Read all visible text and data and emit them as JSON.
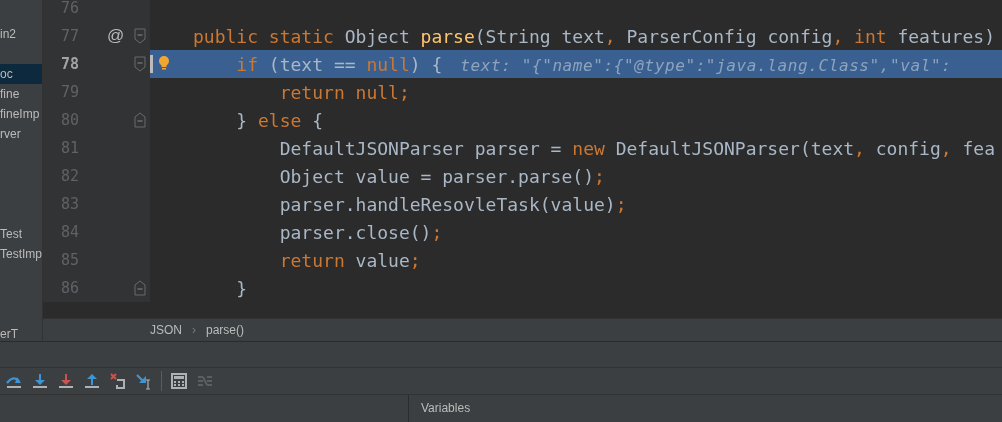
{
  "sidebar": {
    "items": [
      {
        "label": "in2",
        "selected": false
      },
      {
        "label": "oc",
        "selected": true
      },
      {
        "label": "fine",
        "selected": false
      },
      {
        "label": "fineImp",
        "selected": false
      },
      {
        "label": "rver",
        "selected": false
      },
      {
        "label": "Test",
        "selected": false
      },
      {
        "label": "TestImp",
        "selected": false
      },
      {
        "label": "erT",
        "selected": false
      }
    ]
  },
  "editor": {
    "lines": [
      {
        "number": "76",
        "current": false,
        "bulb": false,
        "fold_start": false,
        "fold_end": false
      },
      {
        "number": "77",
        "current": false,
        "bulb": false,
        "fold_start": true,
        "fold_end": false,
        "gutter_mark": "@",
        "tokens": [
          {
            "kind": "keyword",
            "text": "public static "
          },
          {
            "kind": "plain",
            "text": "Object "
          },
          {
            "kind": "method",
            "text": "parse"
          },
          {
            "kind": "plain",
            "text": "(String text"
          },
          {
            "kind": "keyword",
            "text": ", "
          },
          {
            "kind": "plain",
            "text": "ParserConfig config"
          },
          {
            "kind": "keyword",
            "text": ", int "
          },
          {
            "kind": "plain",
            "text": "features)"
          }
        ]
      },
      {
        "number": "78",
        "current": true,
        "bulb": true,
        "fold_start": true,
        "fold_end": false,
        "tokens": [
          {
            "kind": "keyword",
            "text": "    if "
          },
          {
            "kind": "plain",
            "text": "(text == "
          },
          {
            "kind": "keyword",
            "text": "null"
          },
          {
            "kind": "plain",
            "text": ") {"
          },
          {
            "kind": "hint",
            "text": "text: \"{\"name\":{\"@type\":\"java.lang.Class\",\"val\":"
          }
        ]
      },
      {
        "number": "79",
        "current": false,
        "bulb": false,
        "fold_start": false,
        "fold_end": false,
        "tokens": [
          {
            "kind": "keyword",
            "text": "        return null;"
          }
        ]
      },
      {
        "number": "80",
        "current": false,
        "bulb": false,
        "fold_start": false,
        "fold_end": true,
        "tokens": [
          {
            "kind": "plain",
            "text": "    } "
          },
          {
            "kind": "keyword",
            "text": "else "
          },
          {
            "kind": "plain",
            "text": "{"
          }
        ]
      },
      {
        "number": "81",
        "current": false,
        "bulb": false,
        "fold_start": false,
        "fold_end": false,
        "tokens": [
          {
            "kind": "plain",
            "text": "        DefaultJSONParser parser = "
          },
          {
            "kind": "keyword",
            "text": "new "
          },
          {
            "kind": "plain",
            "text": "DefaultJSONParser(text"
          },
          {
            "kind": "keyword",
            "text": ", "
          },
          {
            "kind": "plain",
            "text": "config"
          },
          {
            "kind": "keyword",
            "text": ", "
          },
          {
            "kind": "plain",
            "text": "fea"
          }
        ]
      },
      {
        "number": "82",
        "current": false,
        "bulb": false,
        "fold_start": false,
        "fold_end": false,
        "tokens": [
          {
            "kind": "plain",
            "text": "        Object value = parser.parse()"
          },
          {
            "kind": "keyword",
            "text": ";"
          }
        ]
      },
      {
        "number": "83",
        "current": false,
        "bulb": false,
        "fold_start": false,
        "fold_end": false,
        "tokens": [
          {
            "kind": "plain",
            "text": "        parser.handleResovleTask(value)"
          },
          {
            "kind": "keyword",
            "text": ";"
          }
        ]
      },
      {
        "number": "84",
        "current": false,
        "bulb": false,
        "fold_start": false,
        "fold_end": false,
        "tokens": [
          {
            "kind": "plain",
            "text": "        parser.close()"
          },
          {
            "kind": "keyword",
            "text": ";"
          }
        ]
      },
      {
        "number": "85",
        "current": false,
        "bulb": false,
        "fold_start": false,
        "fold_end": false,
        "tokens": [
          {
            "kind": "keyword",
            "text": "        return "
          },
          {
            "kind": "plain",
            "text": "value"
          },
          {
            "kind": "keyword",
            "text": ";"
          }
        ]
      },
      {
        "number": "86",
        "current": false,
        "bulb": false,
        "fold_start": false,
        "fold_end": true,
        "tokens": [
          {
            "kind": "plain",
            "text": "    }"
          }
        ]
      }
    ]
  },
  "breadcrumbs": {
    "items": [
      "JSON",
      "parse()"
    ],
    "separator": "›"
  },
  "debug_toolbar": [
    {
      "kind": "step-over",
      "disabled": false
    },
    {
      "kind": "step-into",
      "disabled": false
    },
    {
      "kind": "force-step-into",
      "disabled": false
    },
    {
      "kind": "step-out",
      "disabled": false
    },
    {
      "kind": "drop-frame",
      "disabled": false
    },
    {
      "kind": "run-to-cursor",
      "disabled": false
    },
    {
      "kind": "separator",
      "disabled": false
    },
    {
      "kind": "evaluate",
      "disabled": false
    },
    {
      "kind": "trace",
      "disabled": true
    }
  ],
  "variables_panel": {
    "title": "Variables"
  }
}
